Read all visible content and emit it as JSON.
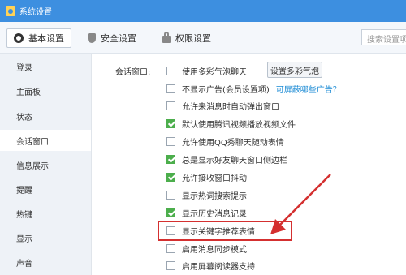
{
  "window": {
    "title": "系统设置"
  },
  "tabs": [
    {
      "label": "基本设置",
      "icon": "gear-icon",
      "active": true
    },
    {
      "label": "安全设置",
      "icon": "shield-icon"
    },
    {
      "label": "权限设置",
      "icon": "lock-icon"
    }
  ],
  "search": {
    "placeholder": "搜索设置项"
  },
  "sidebar": {
    "items": [
      {
        "label": "登录"
      },
      {
        "label": "主面板"
      },
      {
        "label": "状态"
      },
      {
        "label": "会话窗口",
        "active": true
      },
      {
        "label": "信息展示"
      },
      {
        "label": "提醒"
      },
      {
        "label": "热键"
      },
      {
        "label": "显示"
      },
      {
        "label": "声音"
      }
    ]
  },
  "main": {
    "section_label": "会话窗口:",
    "bubble_button": "设置多彩气泡",
    "options": [
      {
        "label": "使用多彩气泡聊天",
        "checked": false
      },
      {
        "label": "不显示广告(会员设置项)",
        "checked": false,
        "link": "可屏蔽哪些广告？"
      },
      {
        "label": "允许来消息时自动弹出窗口",
        "checked": false
      },
      {
        "label": "默认使用腾讯视频播放视频文件",
        "checked": true
      },
      {
        "label": "允许使用QQ秀聊天随动表情",
        "checked": false
      },
      {
        "label": "总是显示好友聊天窗口侧边栏",
        "checked": true
      },
      {
        "label": "允许接收窗口抖动",
        "checked": true
      },
      {
        "label": "显示热词搜索提示",
        "checked": false
      },
      {
        "label": "显示历史消息记录",
        "checked": true
      },
      {
        "label": "显示关键字推荐表情",
        "checked": false,
        "highlighted": true
      },
      {
        "label": "启用消息同步模式",
        "checked": false
      },
      {
        "label": "启用屏幕阅读器支持",
        "checked": false
      }
    ]
  },
  "colors": {
    "titlebar": "#3d8fe0",
    "checked": "#4cae4c",
    "link": "#1a8ad4",
    "annotation": "#d43030"
  }
}
